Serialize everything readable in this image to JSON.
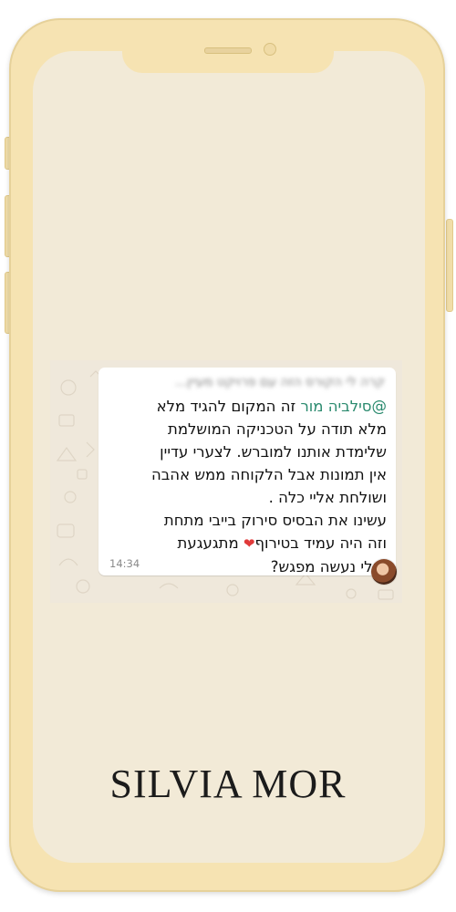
{
  "chat": {
    "quoted_text": "קרה לי הקורס הזה עם פרויקט מעיין...",
    "mention": "@סילביה מור",
    "message_lines": [
      "זה המקום להגיד מלא",
      "מלא תודה על הטכניקה המושלמת",
      "שלימדת אותנו למוברש. לצערי עדיין",
      "אין תמונות אבל הלקוחה ממש אהבה",
      "ושולחת אליי כלה .",
      "עשינו את הבסיס סירוק בייבי מתחת",
      "וזה היה עמיד בטירוף",
      "מתגעגעת",
      "אולי נעשה מפגש?"
    ],
    "heart": "❤",
    "timestamp": "14:34"
  },
  "brand": {
    "name": "SILVIA MOR"
  },
  "icons": [
    "heart-emoji-icon",
    "avatar"
  ],
  "colors": {
    "mention": "#2a8a6e",
    "heart": "#e03a3a",
    "phone_frame": "#f6e3b2",
    "screen": "#f2ead7"
  }
}
